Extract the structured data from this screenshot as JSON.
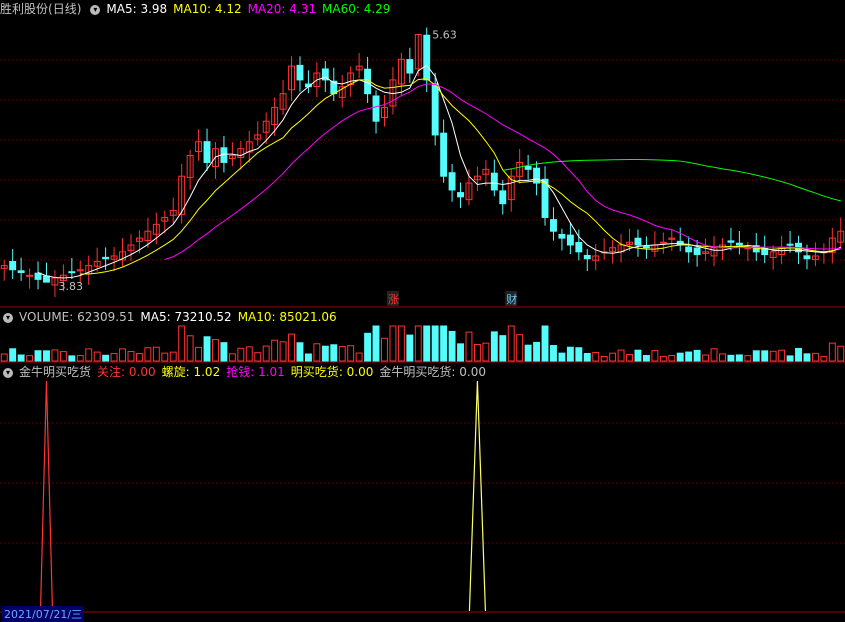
{
  "price_panel": {
    "stock_name": "胜利股份",
    "period": "(日线)",
    "indicators": [
      {
        "name": "MA5",
        "value": "3.98",
        "color": "#ffffff"
      },
      {
        "name": "MA10",
        "value": "4.12",
        "color": "#ffff00"
      },
      {
        "name": "MA20",
        "value": "4.31",
        "color": "#ff00ff"
      },
      {
        "name": "MA60",
        "value": "4.29",
        "color": "#00ff00"
      }
    ],
    "high_label": "5.63",
    "low_label": "3.83",
    "events": [
      {
        "label": "涨",
        "color": "#ff3333",
        "index": 46
      },
      {
        "label": "财",
        "color": "#66ccff",
        "index": 60
      }
    ]
  },
  "volume_panel": {
    "title": "VOLUME",
    "value": "62309.51",
    "ma5_label": "MA5",
    "ma5": "73210.52",
    "ma10_label": "MA10",
    "ma10": "85021.06"
  },
  "indicator_panel": {
    "title": "金牛明买吃货",
    "items": [
      {
        "name": "关注",
        "value": "0.00",
        "color": "#ff3333"
      },
      {
        "name": "螺旋",
        "value": "1.02",
        "color": "#ffff00"
      },
      {
        "name": "抢钱",
        "value": "1.01",
        "color": "#ff00ff"
      },
      {
        "name": "明买吃货",
        "value": "0.00",
        "color": "#ffff00"
      },
      {
        "name": "金牛明买吃货",
        "value": "0.00",
        "color": "#c0c0c0"
      }
    ]
  },
  "bottom_date": "2021/07/21/三",
  "colors": {
    "up": "#ff3232",
    "down": "#54fcfc",
    "grid": "#7a0000",
    "ma5": "#ffffff",
    "ma10": "#ffff00",
    "ma20": "#ff00ff",
    "ma60": "#00ff00"
  },
  "chart_data": {
    "type": "candlestick",
    "series_close": [
      3.95,
      3.92,
      3.9,
      3.88,
      3.85,
      3.83,
      3.86,
      3.88,
      3.9,
      3.92,
      3.95,
      3.98,
      4.0,
      4.02,
      4.05,
      4.1,
      4.15,
      4.2,
      4.25,
      4.3,
      4.35,
      4.6,
      4.75,
      4.85,
      4.7,
      4.8,
      4.7,
      4.75,
      4.8,
      4.85,
      4.9,
      5.0,
      5.1,
      5.2,
      5.4,
      5.3,
      5.25,
      5.35,
      5.3,
      5.2,
      5.25,
      5.35,
      5.4,
      5.2,
      5.0,
      5.1,
      5.3,
      5.45,
      5.35,
      5.63,
      5.3,
      4.9,
      4.6,
      4.5,
      4.45,
      4.55,
      4.6,
      4.65,
      4.5,
      4.4,
      4.6,
      4.7,
      4.65,
      4.55,
      4.3,
      4.2,
      4.15,
      4.1,
      4.05,
      4.0,
      4.02,
      4.05,
      4.08,
      4.1,
      4.12,
      4.1,
      4.08,
      4.1,
      4.12,
      4.15,
      4.1,
      4.05,
      4.03,
      4.05,
      4.08,
      4.1,
      4.12,
      4.1,
      4.08,
      4.05,
      4.03,
      4.05,
      4.08,
      4.1,
      4.05,
      4.0,
      4.02,
      4.05,
      4.15,
      4.2
    ],
    "volume_ylim": [
      0,
      160000
    ],
    "price_ylim": [
      3.7,
      5.75
    ],
    "signal_guanzhu_index": 5,
    "signal_mingmai_index": 56
  }
}
